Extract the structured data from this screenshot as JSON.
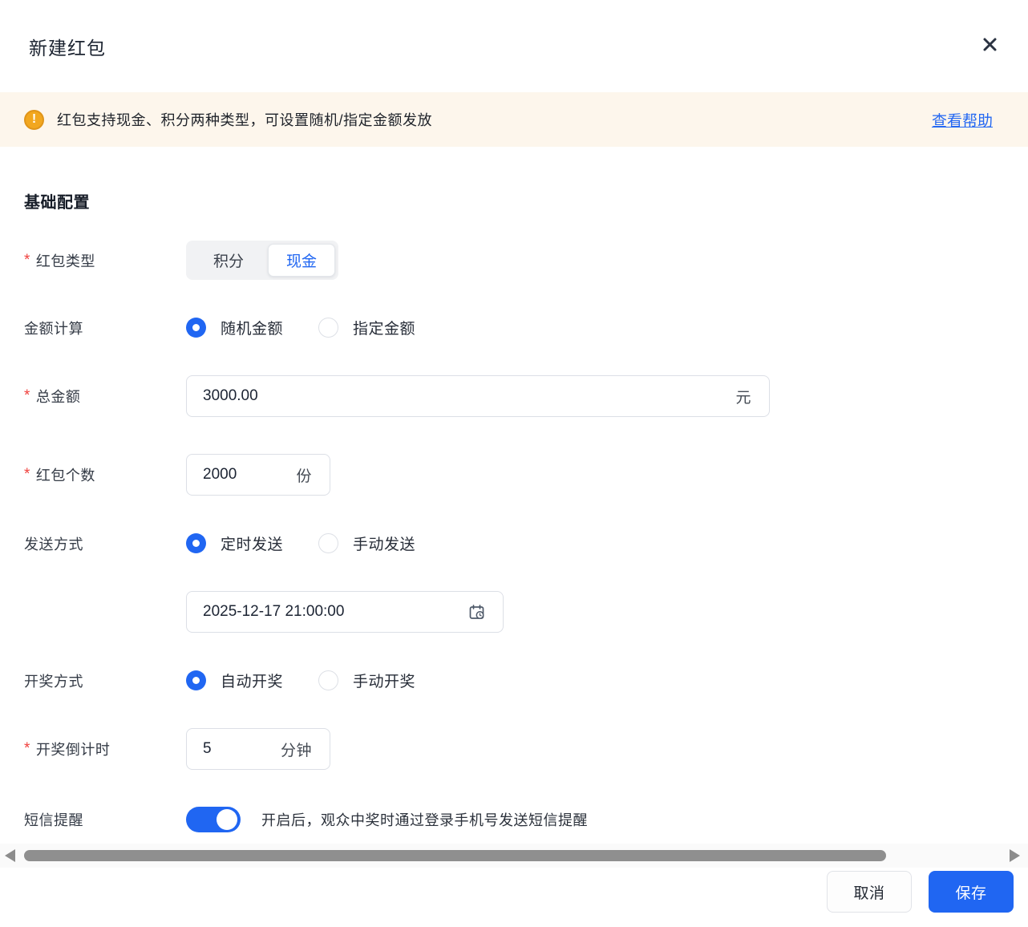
{
  "dialog": {
    "title": "新建红包"
  },
  "banner": {
    "text": "红包支持现金、积分两种类型，可设置随机/指定金额发放",
    "help_link": "查看帮助"
  },
  "section": {
    "title": "基础配置"
  },
  "required_mark": "*",
  "form": {
    "packet_type": {
      "label": "红包类型",
      "options": [
        "积分",
        "现金"
      ],
      "selected": "现金"
    },
    "amount_calc": {
      "label": "金额计算",
      "options": [
        "随机金额",
        "指定金额"
      ],
      "selected": "随机金额"
    },
    "total_amount": {
      "label": "总金额",
      "value": "3000.00",
      "suffix": "元"
    },
    "packet_count": {
      "label": "红包个数",
      "value": "2000",
      "suffix": "份"
    },
    "send_mode": {
      "label": "发送方式",
      "options": [
        "定时发送",
        "手动发送"
      ],
      "selected": "定时发送"
    },
    "send_time": {
      "value": "2025-12-17 21:00:00"
    },
    "draw_mode": {
      "label": "开奖方式",
      "options": [
        "自动开奖",
        "手动开奖"
      ],
      "selected": "自动开奖"
    },
    "countdown": {
      "label": "开奖倒计时",
      "value": "5",
      "suffix": "分钟"
    },
    "sms_notify": {
      "label": "短信提醒",
      "state": "on",
      "hint": "开启后，观众中奖时通过登录手机号发送短信提醒"
    }
  },
  "footer": {
    "cancel": "取消",
    "save": "保存"
  },
  "colors": {
    "primary": "#2066F2",
    "banner_bg": "#FDF6EC",
    "warning_orange": "#F2A71F",
    "link_blue": "#2468F2"
  }
}
